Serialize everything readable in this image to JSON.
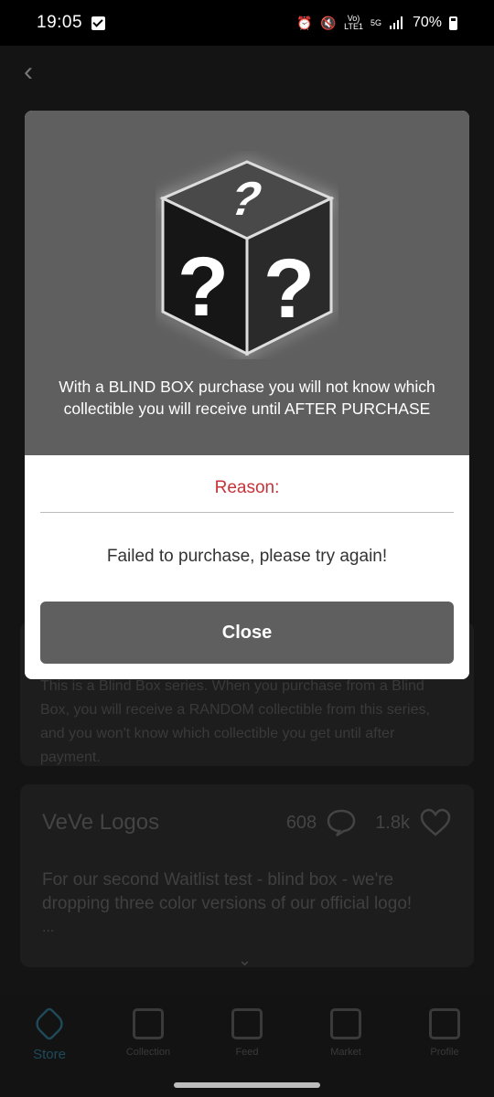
{
  "status_bar": {
    "time": "19:05",
    "network_label": "LTE1",
    "network_type": "5G",
    "battery": "70%",
    "icons": [
      "checkbox-notification-icon",
      "alarm-icon",
      "mute-icon",
      "volte-icon",
      "signal-icon",
      "battery-icon"
    ]
  },
  "modal": {
    "message": "With a BLIND BOX purchase you will not know which collectible you will receive until AFTER PURCHASE",
    "reason_label": "Reason:",
    "failure_message": "Failed to purchase, please try again!",
    "close_label": "Close"
  },
  "background": {
    "blind_box_note": "This is a Blind Box series. When you purchase from a Blind Box, you will receive a RANDOM collectible from this series, and you won't know which collectible you get until after payment.",
    "card": {
      "title": "VeVe Logos",
      "comments_count": "608",
      "likes_count": "1.8k",
      "description": "For our second Waitlist test - blind box - we're dropping three color versions of our official logo!",
      "more": "..."
    }
  },
  "bottom_nav": {
    "items": [
      {
        "label": "Store",
        "icon": "store-tag-icon",
        "active": true
      },
      {
        "label": "Collection",
        "icon": "collection-box-icon",
        "active": false
      },
      {
        "label": "Feed",
        "icon": "feed-icon",
        "active": false
      },
      {
        "label": "Market",
        "icon": "market-icon",
        "active": false
      },
      {
        "label": "Profile",
        "icon": "profile-icon",
        "active": false
      }
    ]
  },
  "colors": {
    "modal_top_bg": "#5f5f5f",
    "reason_red": "#c4343a",
    "close_button_bg": "#5f5f5f"
  }
}
